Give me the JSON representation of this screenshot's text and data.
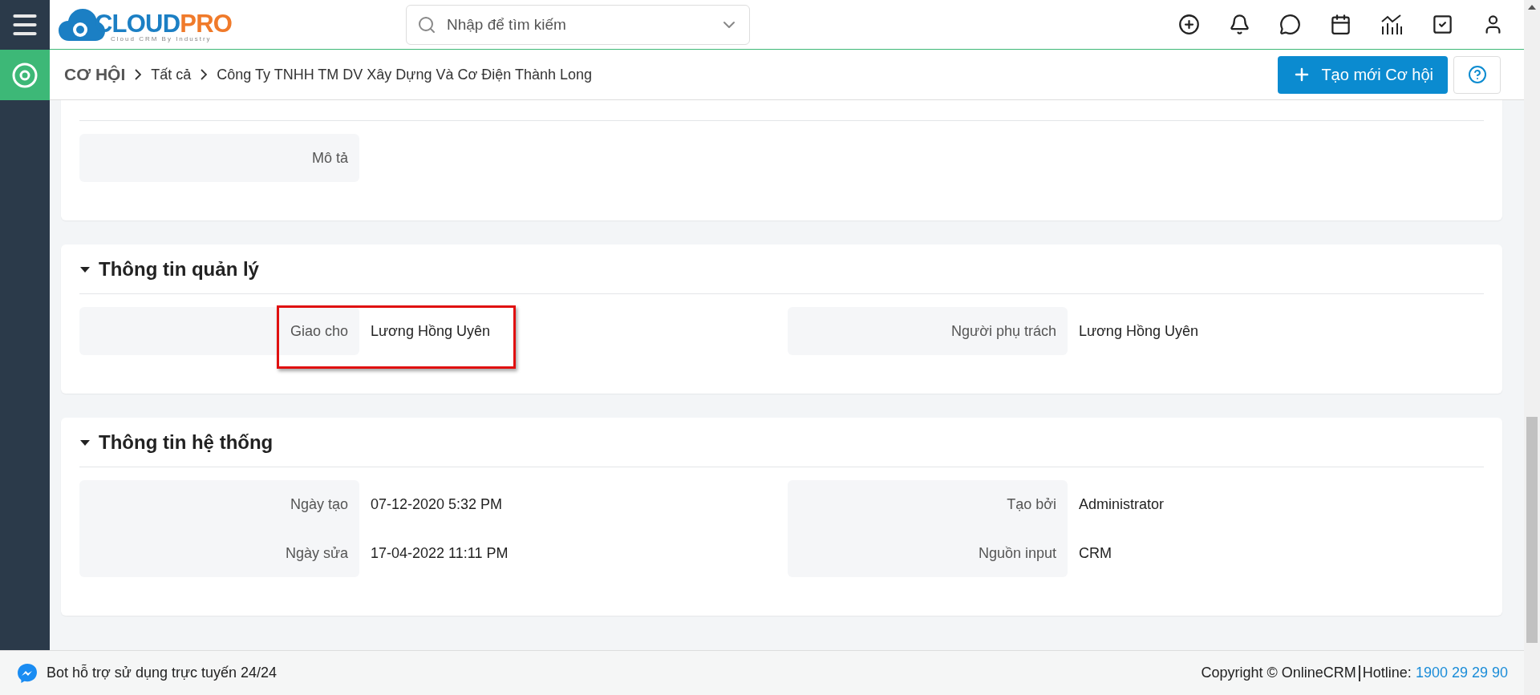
{
  "logo": {
    "brand_left": "CLOUD",
    "brand_right": "PRO",
    "tagline": "Cloud CRM By Industry"
  },
  "search": {
    "placeholder": "Nhập để tìm kiếm"
  },
  "breadcrumb": {
    "module": "CƠ HỘI",
    "items": [
      "Tất cả",
      "Công Ty TNHH TM DV Xây Dựng Và Cơ Điện Thành Long"
    ]
  },
  "actions": {
    "create_button": "Tạo mới Cơ hội"
  },
  "sections": [
    {
      "columns": [
        [
          {
            "label": "Mô tả"
          }
        ]
      ]
    },
    {
      "title": "Thông tin quản lý",
      "expanded": true,
      "columns": [
        [
          {
            "label": "Giao cho",
            "value": "Lương Hồng Uyên",
            "highlighted": true
          }
        ],
        [
          {
            "label": "Người phụ trách",
            "value": "Lương Hồng Uyên"
          }
        ]
      ]
    },
    {
      "title": "Thông tin hệ thống",
      "expanded": true,
      "columns": [
        [
          {
            "label": "Ngày tạo",
            "value": "07-12-2020 5:32 PM"
          },
          {
            "label": "Ngày sửa",
            "value": "17-04-2022 11:11 PM"
          }
        ],
        [
          {
            "label": "Tạo bởi",
            "value": "Administrator"
          },
          {
            "label": "Nguồn input",
            "value": "CRM"
          }
        ]
      ]
    }
  ],
  "footer": {
    "support_text": "Bot hỗ trợ sử dụng trực tuyến 24/24",
    "copyright": "Copyright © OnlineCRM",
    "hotline_label": "Hotline:",
    "hotline": "1900 29 29 90"
  }
}
